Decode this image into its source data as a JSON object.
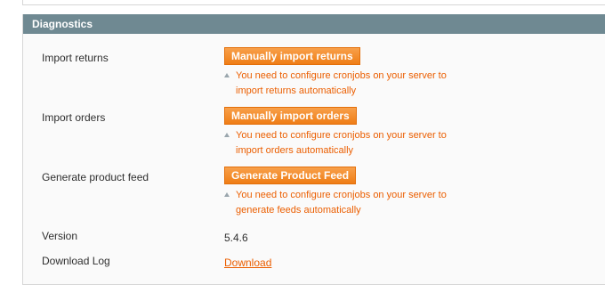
{
  "section": {
    "title": "Diagnostics"
  },
  "rows": {
    "import_returns": {
      "label": "Import returns",
      "button": "Manually import returns",
      "note_line1": "You need to configure cronjobs on your server to",
      "note_line2": "import returns automatically"
    },
    "import_orders": {
      "label": "Import orders",
      "button": "Manually import orders",
      "note_line1": "You need to configure cronjobs on your server to",
      "note_line2": "import orders automatically"
    },
    "product_feed": {
      "label": "Generate product feed",
      "button": "Generate Product Feed",
      "note_line1": "You need to configure cronjobs on your server to",
      "note_line2": "generate feeds automatically"
    },
    "version": {
      "label": "Version",
      "value": "5.4.6"
    },
    "download_log": {
      "label": "Download Log",
      "link": "Download"
    }
  },
  "colors": {
    "header_bg": "#6f8992",
    "button_orange": "#ef7d16",
    "note_text": "#eb5e00"
  }
}
